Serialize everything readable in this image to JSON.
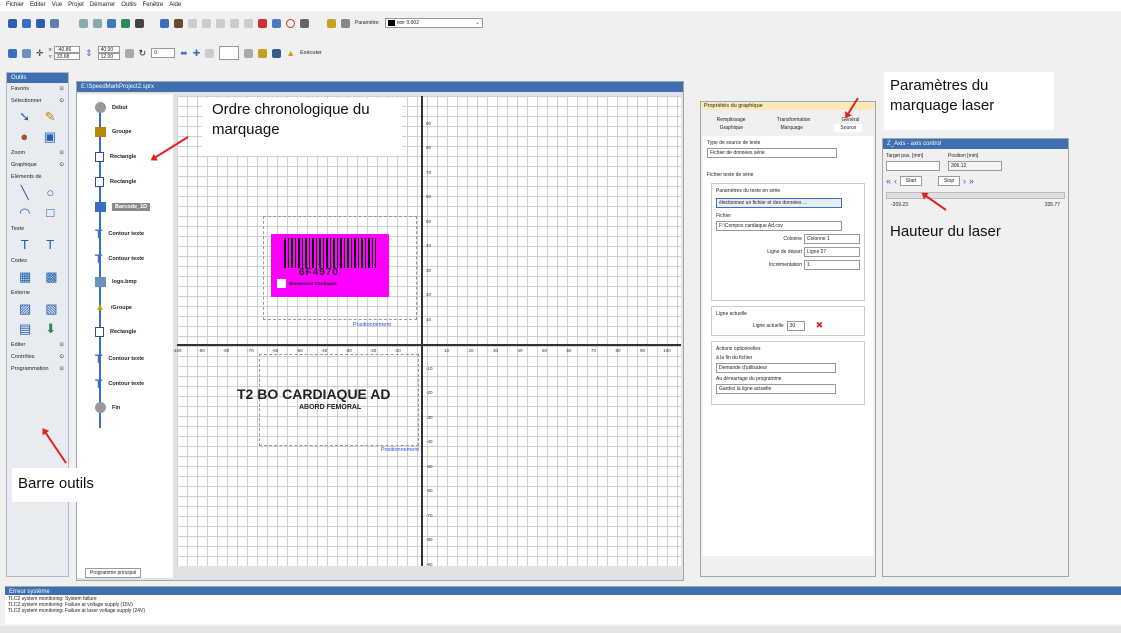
{
  "menu": [
    "Fichier",
    "Editer",
    "Vue",
    "Projet",
    "Démarrer",
    "Outils",
    "Fenêtre",
    "Aide"
  ],
  "toolbar": {
    "param_label": "Paramètre:",
    "param_value": "noir 0.002",
    "x": "-40.86",
    "y": "33.68",
    "w": "40.00",
    "h": "12.00",
    "rot": "0",
    "execute": "Exécuter"
  },
  "left_panel": {
    "title": "Outils",
    "sections": [
      "Favoris",
      "Sélectionner",
      "Zoom",
      "Graphique",
      "Eléments de"
    ],
    "texte": "Texte",
    "codes": "Codes",
    "externe": "Externe",
    "bottom": [
      "Editer",
      "Contrôles",
      "Programmation"
    ]
  },
  "document": {
    "title": "E:\\SpeedMarkProject2.sprx",
    "tab": "Programme principal"
  },
  "tree": [
    "Début",
    "Groupe",
    "Rectangle",
    "Rectangle",
    "Barcode_1D",
    "Contour texte",
    "Contour texte",
    "logo.bmp",
    "/Groupe",
    "Rectangle",
    "Contour texte",
    "Contour texte",
    "Fin"
  ],
  "canvas": {
    "barcode_text": "6F4970",
    "small_text": "Biosenseur Cardiaque",
    "pos_label": "Positionnement",
    "big_text": "T2 BO CARDIAQUE AD",
    "sub_text": "ABORD FEMORAL",
    "x_ticks": [
      "-100",
      "-90",
      "-80",
      "-70",
      "-60",
      "-50",
      "-40",
      "-30",
      "-20",
      "-10",
      "10",
      "20",
      "30",
      "40",
      "50",
      "60",
      "70",
      "80",
      "90",
      "100"
    ],
    "y_ticks": [
      "90",
      "80",
      "70",
      "60",
      "50",
      "40",
      "30",
      "20",
      "10",
      "-10",
      "-20",
      "-30",
      "-40",
      "-50",
      "-60",
      "-70",
      "-80",
      "-90"
    ]
  },
  "props": {
    "title": "Propriétés du graphique",
    "tabs_top": [
      "Remplissage",
      "Transformation",
      "Général"
    ],
    "tabs_bot": [
      "Graphique",
      "Marquage",
      "Source"
    ],
    "source_type_label": "Type de source de texte",
    "source_type": "Fichier de données série",
    "file_group": "Fichier texte de série",
    "params": "Paramètres du texte en série",
    "select_btn": "électionnez un fichier et des données ...",
    "file_label": "Fichier",
    "file": "F:\\Compos cardiaque Ad.csv",
    "col_label": "Colonne",
    "col": "Colonne 1",
    "start_label": "Ligne de départ",
    "start": "Ligne 27",
    "inc_label": "Incrémentation",
    "inc": "1",
    "current_group": "Ligne actuelle",
    "current_label": "Ligne actuelle",
    "current": "30",
    "actions": "Actions optionnelles",
    "end_label": "à la fin du fichier",
    "end_val": "Demande d'utilisateur",
    "startup_label": "Au démarrage du programme",
    "startup_val": "Gardez la ligne actuelle"
  },
  "axis": {
    "title": "Z_Axis - axis control",
    "target_label": "Target pos. [mm]",
    "pos_label": "Position [mm]",
    "pos": "306.12",
    "start": "Start",
    "stop": "Stop",
    "min": "-209.23",
    "max": "335.77"
  },
  "errors": {
    "title": "Erreur système",
    "lines": [
      "TLC2 system monitoring: System failure",
      "TLC2 system monitoring: Failure at voltage supply (15V)",
      "TLC2 system monitoring: Failure at laser voltage supply (24V)"
    ]
  },
  "annotations": {
    "order": "Ordre chronologique du marquage",
    "params": "Paramètres du marquage laser",
    "height": "Hauteur du laser",
    "toolbar": "Barre outils"
  }
}
